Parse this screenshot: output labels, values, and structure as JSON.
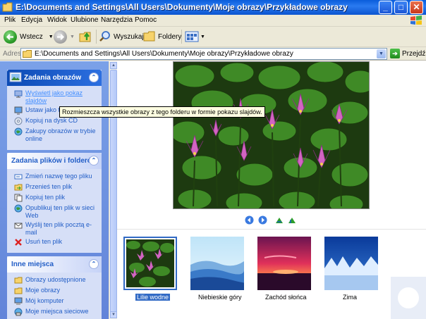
{
  "window": {
    "title": "E:\\Documents and Settings\\All Users\\Dokumenty\\Moje obrazy\\Przykładowe obrazy",
    "minimize": "_",
    "maximize": "□",
    "close": "✕"
  },
  "menu": [
    "Plik",
    "Edycja",
    "Widok",
    "Ulubione",
    "Narzędzia",
    "Pomoc"
  ],
  "toolbar": {
    "back_label": "Wstecz",
    "search_label": "Wyszukaj",
    "folders_label": "Foldery"
  },
  "address": {
    "label": "Adres",
    "value": "E:\\Documents and Settings\\All Users\\Dokumenty\\Moje obrazy\\Przykładowe obrazy",
    "go_label": "Przejdź"
  },
  "panels": {
    "picture_tasks": {
      "title": "Zadania obrazów",
      "items": [
        "Wyświetl jako pokaz slajdów",
        "Ustaw jako tło pulpitu",
        "Kopiuj na dysk CD",
        "Zakupy obrazów w trybie online"
      ]
    },
    "file_tasks": {
      "title": "Zadania plików i folderów",
      "items": [
        "Zmień nazwę tego pliku",
        "Przenieś ten plik",
        "Kopiuj ten plik",
        "Opublikuj ten plik w sieci Web",
        "Wyślij ten plik pocztą e-mail",
        "Usuń ten plik"
      ]
    },
    "other_places": {
      "title": "Inne miejsca",
      "items": [
        "Obrazy udostępnione",
        "Moje obrazy",
        "Mój komputer",
        "Moje miejsca sieciowe"
      ]
    }
  },
  "tooltip": "Rozmieszcza wszystkie obrazy z tego folderu w formie pokazu slajdów.",
  "thumbnails": [
    {
      "label": "Lilie wodne",
      "selected": true
    },
    {
      "label": "Niebieskie góry",
      "selected": false
    },
    {
      "label": "Zachód słońca",
      "selected": false
    },
    {
      "label": "Zima",
      "selected": false
    }
  ],
  "colors": {
    "title_bar": "#0a5ddb",
    "task_panel": "#d6dff7",
    "link": "#215dc6",
    "selection": "#316ac5"
  }
}
